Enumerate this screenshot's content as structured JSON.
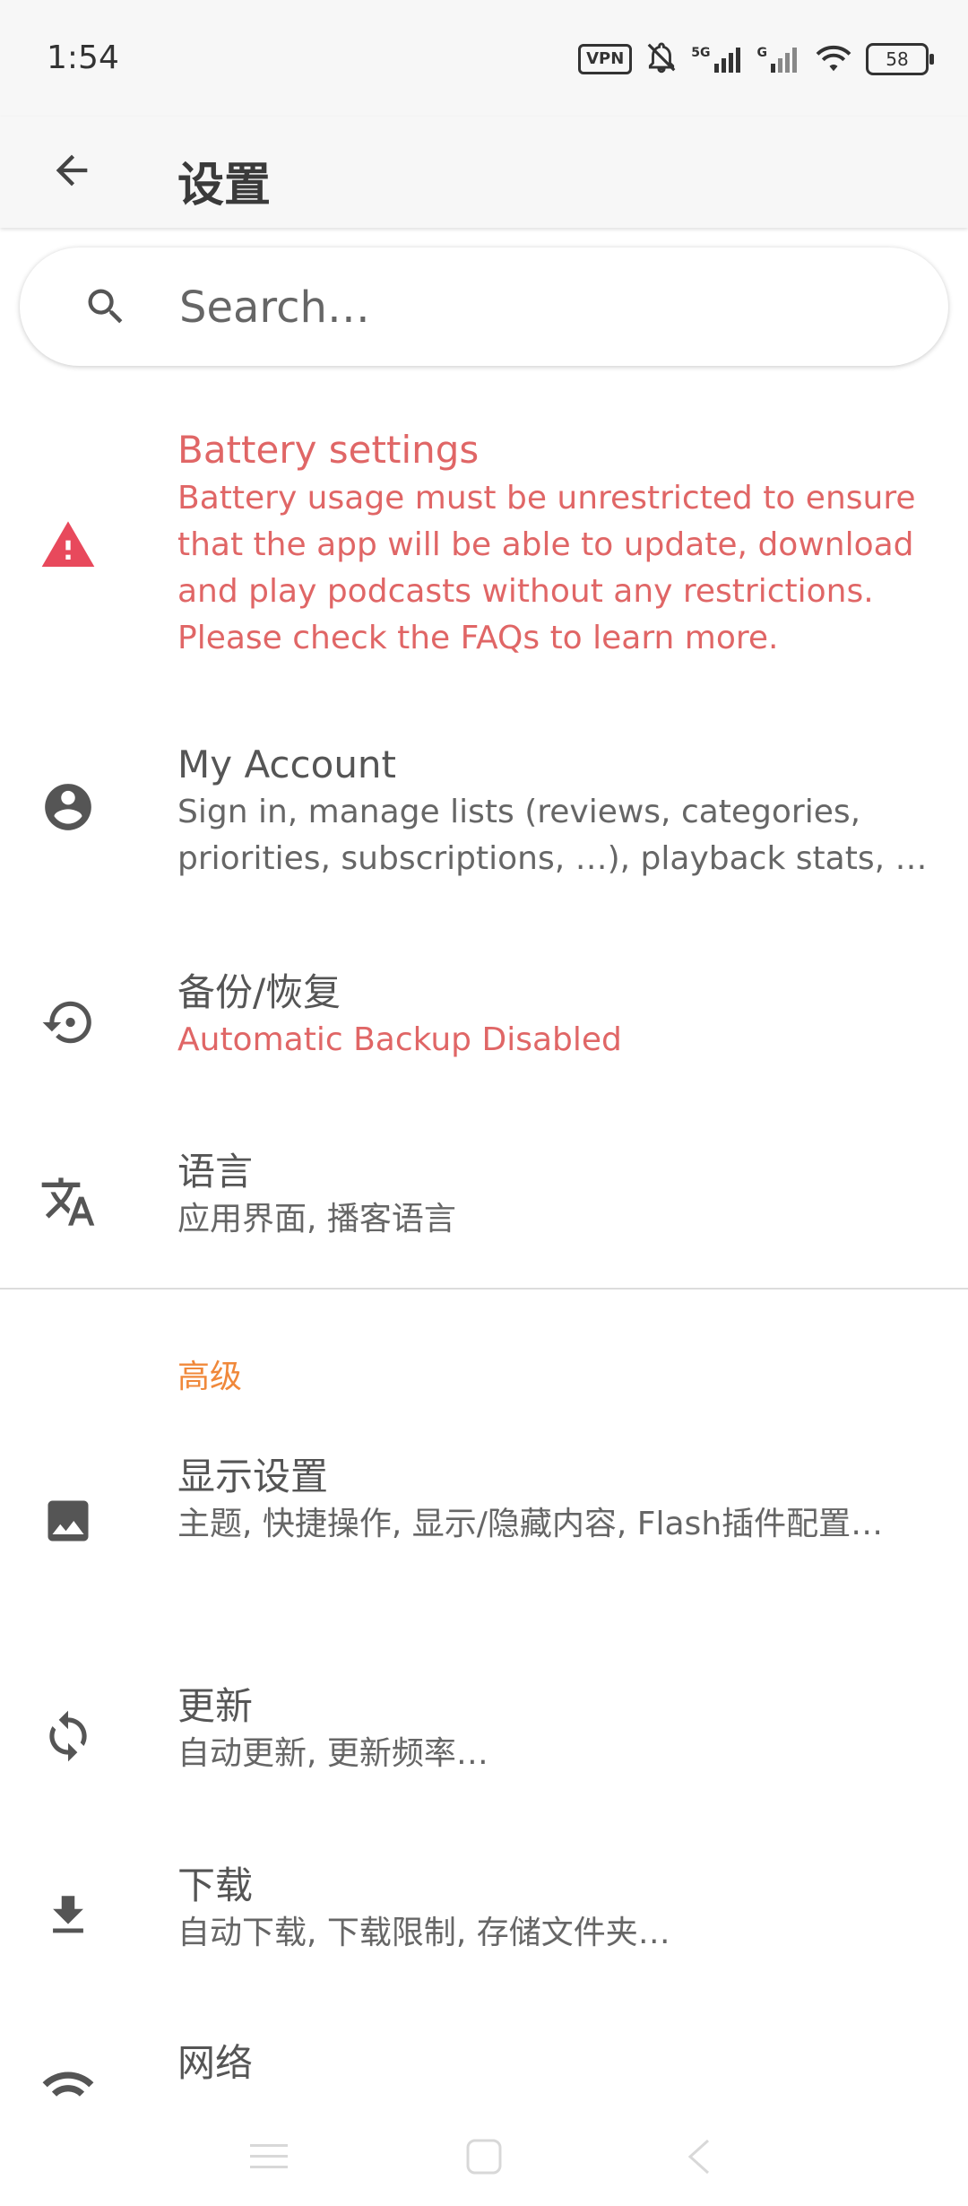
{
  "status_bar": {
    "time": "1:54",
    "vpn": "VPN",
    "signal_1": "5G",
    "signal_2": "G",
    "battery": "58"
  },
  "app_bar": {
    "title": "设置",
    "back_icon": "arrow-back-icon"
  },
  "search": {
    "placeholder": "Search…",
    "value": ""
  },
  "rows": {
    "battery": {
      "icon": "warning-icon",
      "title": "Battery settings",
      "subtitle": "Battery usage must be unrestricted to ensure that the app will be able to update, download and play podcasts without any restrictions. Please check the FAQs to learn more."
    },
    "account": {
      "icon": "account-circle-icon",
      "title": "My Account",
      "subtitle": "Sign in, manage lists (reviews, categories, priorities, subscriptions, …), playback stats, …"
    },
    "backup": {
      "icon": "restore-icon",
      "title": "备份/恢复",
      "subtitle": "Automatic Backup Disabled"
    },
    "language": {
      "icon": "translate-icon",
      "title": "语言",
      "subtitle": "应用界面, 播客语言"
    }
  },
  "advanced": {
    "header": "高级",
    "display": {
      "icon": "image-icon",
      "title": "显示设置",
      "subtitle": "主题, 快捷操作, 显示/隐藏内容, Flash插件配置…"
    },
    "update": {
      "icon": "sync-icon",
      "title": "更新",
      "subtitle": "自动更新, 更新频率…"
    },
    "download": {
      "icon": "download-icon",
      "title": "下载",
      "subtitle": "自动下载, 下载限制, 存储文件夹…"
    },
    "network": {
      "icon": "wifi-icon",
      "title": "网络"
    }
  },
  "colors": {
    "accent_red": "#e06666",
    "section_orange": "#f0883a",
    "bar_bg": "#f7f7f7"
  }
}
